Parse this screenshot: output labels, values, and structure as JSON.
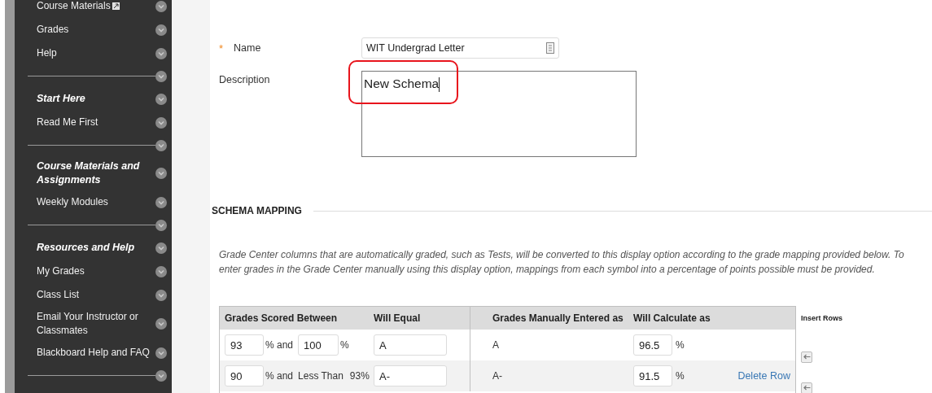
{
  "sidebar": {
    "items": [
      {
        "kind": "link",
        "label": "Course Materials",
        "external": true
      },
      {
        "kind": "link",
        "label": "Grades",
        "external": false
      },
      {
        "kind": "link",
        "label": "Help",
        "external": false
      },
      {
        "kind": "divider"
      },
      {
        "kind": "heading",
        "label": "Start Here"
      },
      {
        "kind": "link",
        "label": "Read Me First",
        "external": false
      },
      {
        "kind": "divider"
      },
      {
        "kind": "heading",
        "label": "Course Materials and Assignments"
      },
      {
        "kind": "link",
        "label": "Weekly Modules",
        "external": false
      },
      {
        "kind": "divider"
      },
      {
        "kind": "heading",
        "label": "Resources and Help"
      },
      {
        "kind": "link",
        "label": "My Grades",
        "external": false
      },
      {
        "kind": "link",
        "label": "Class List",
        "external": false
      },
      {
        "kind": "link",
        "label": "Email Your Instructor or Classmates",
        "external": false
      },
      {
        "kind": "link",
        "label": "Blackboard Help and FAQ",
        "external": false
      },
      {
        "kind": "divider"
      }
    ]
  },
  "schema_information": {
    "name": {
      "label": "Name",
      "required_mark": "*",
      "value": "WIT Undergrad Letter"
    },
    "description": {
      "label": "Description",
      "value": "New Schema",
      "highlighted": true
    }
  },
  "schema_mapping": {
    "title": "SCHEMA MAPPING",
    "instructions": "Grade Center columns that are automatically graded, such as Tests, will be converted to this display option according to the grade mapping provided below. To enter grades in the Grade Center manually using this display option, mappings from each symbol into a percentage of points possible must be provided.",
    "columns": [
      "Grades Scored Between",
      "Will Equal",
      "Grades Manually Entered as",
      "Will Calculate as"
    ],
    "insert_rows_label": "Insert Rows",
    "rows": [
      {
        "from": "93",
        "and": "% and",
        "upper": {
          "kind": "input",
          "value": "100",
          "suffix": "%"
        },
        "equals": "A",
        "manual": "A",
        "calculate": "96.5",
        "percent": "%"
      },
      {
        "from": "90",
        "and": "% and",
        "upper": {
          "kind": "text",
          "label": "Less Than",
          "value": "93%"
        },
        "equals": "A-",
        "manual": "A-",
        "calculate": "91.5",
        "percent": "%",
        "delete": "Delete Row"
      }
    ]
  }
}
